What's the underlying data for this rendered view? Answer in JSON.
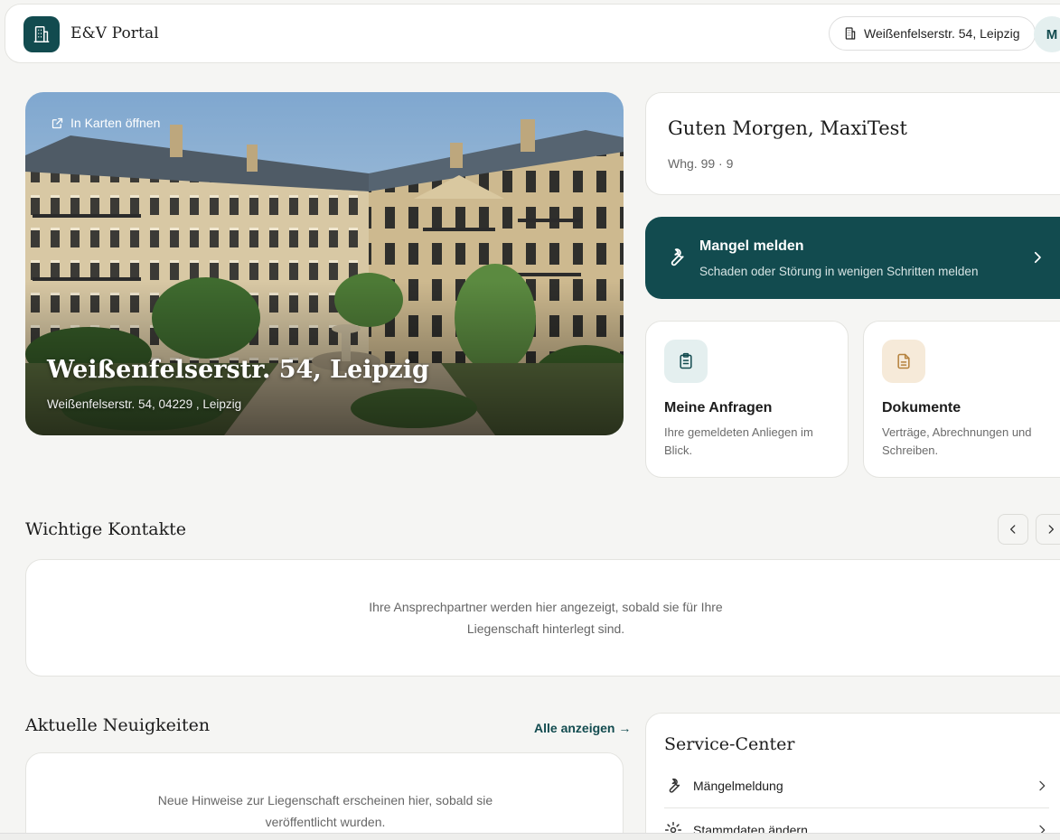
{
  "header": {
    "brand": "E&V Portal",
    "address": "Weißenfelserstr. 54, Leipzig",
    "avatar_initial": "M"
  },
  "hero": {
    "maps_link": "In Karten öffnen",
    "title": "Weißenfelserstr. 54, Leipzig",
    "subtitle": "Weißenfelserstr. 54, 04229 , Leipzig"
  },
  "greeting": {
    "title": "Guten Morgen, MaxiTest",
    "unit": "Whg. 99 · 9"
  },
  "report": {
    "title": "Mangel melden",
    "subtitle": "Schaden oder Störung in wenigen Schritten melden"
  },
  "tiles": [
    {
      "title": "Meine Anfragen",
      "desc": "Ihre gemeldeten Anliegen im Blick.",
      "icon": "clipboard-icon",
      "color": "#e4efef"
    },
    {
      "title": "Dokumente",
      "desc": "Verträge, Abrechnungen und Schreiben.",
      "icon": "document-icon",
      "color": "#f6ead9"
    }
  ],
  "contacts": {
    "title": "Wichtige Kontakte",
    "empty_line1": "Ihre Ansprechpartner werden hier angezeigt, sobald sie für Ihre",
    "empty_line2": "Liegenschaft hinterlegt sind."
  },
  "news": {
    "title": "Aktuelle Neuigkeiten",
    "all_link": "Alle anzeigen →",
    "empty_line1": "Neue Hinweise zur Liegenschaft erscheinen hier, sobald sie",
    "empty_line2": "veröffentlicht wurden."
  },
  "service": {
    "title": "Service-Center",
    "items": [
      {
        "label": "Mängelmeldung",
        "icon": "wrench-icon"
      },
      {
        "label": "Stammdaten ändern",
        "icon": "gear-icon"
      }
    ]
  },
  "colors": {
    "accent": "#124b4f",
    "background": "#f5f5f3"
  }
}
